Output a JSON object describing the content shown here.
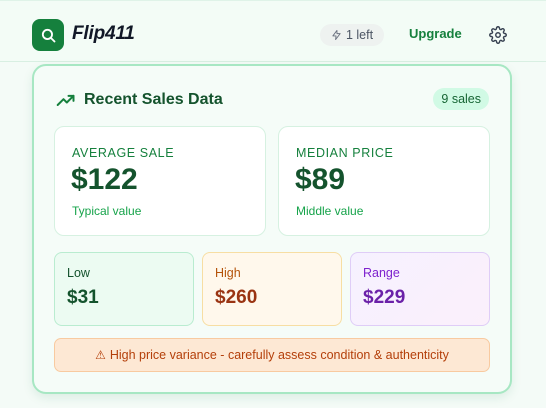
{
  "header": {
    "app_title": "Flip411",
    "logo_icon": "search-icon",
    "credits_text": "1 left",
    "credits_icon": "lightning-icon",
    "upgrade_label": "Upgrade",
    "settings_icon": "gear-icon"
  },
  "panel": {
    "title": "Recent Sales Data",
    "title_icon": "trending-up-icon",
    "count_badge": "9 sales",
    "average": {
      "label": "AVERAGE SALE",
      "value": "$122",
      "sub": "Typical value"
    },
    "median": {
      "label": "MEDIAN PRICE",
      "value": "$89",
      "sub": "Middle value"
    },
    "low": {
      "label": "Low",
      "value": "$31"
    },
    "high": {
      "label": "High",
      "value": "$260"
    },
    "range": {
      "label": "Range",
      "value": "$229"
    },
    "warning": "High price variance - carefully assess condition & authenticity",
    "warning_icon": "warning-triangle-icon"
  },
  "colors": {
    "brand_green": "#15803d",
    "dark_green": "#14532d",
    "high_orange": "#9a3412",
    "range_purple": "#6b21a8",
    "warning_text": "#b43f0a"
  }
}
